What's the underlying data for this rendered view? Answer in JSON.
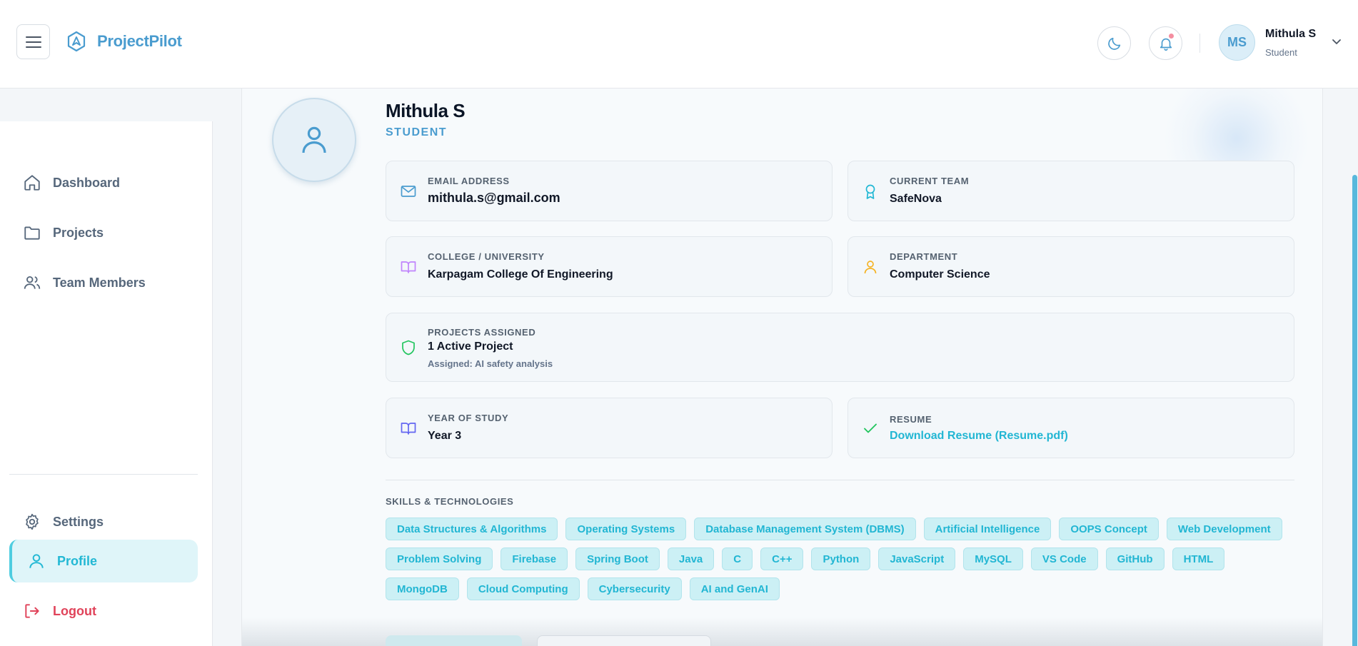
{
  "app": {
    "brand_name": "ProjectPilot",
    "accent_color": "#4a9ccf",
    "cyan_color": "#22b6d3"
  },
  "header": {
    "menu_icon": "hamburger-icon",
    "theme_icon": "moon-icon",
    "notification_icon": "bell-icon",
    "user": {
      "initials": "MS",
      "name": "Mithula S",
      "role": "Student"
    }
  },
  "sidebar": {
    "items": [
      {
        "label": "Dashboard",
        "icon": "home-icon"
      },
      {
        "label": "Projects",
        "icon": "folder-icon"
      },
      {
        "label": "Team Members",
        "icon": "users-icon"
      }
    ],
    "bottom": [
      {
        "label": "Settings",
        "icon": "gear-icon"
      },
      {
        "label": "Profile",
        "icon": "user-icon",
        "active": true
      },
      {
        "label": "Logout",
        "icon": "logout-icon"
      }
    ]
  },
  "profile": {
    "name": "Mithula S",
    "role": "STUDENT",
    "email": {
      "label": "EMAIL ADDRESS",
      "value": "mithula.s@gmail.com"
    },
    "team": {
      "label": "CURRENT TEAM",
      "value": "SafeNova"
    },
    "college": {
      "label": "COLLEGE / UNIVERSITY",
      "value": "Karpagam College Of Engineering"
    },
    "department": {
      "label": "DEPARTMENT",
      "value": "Computer Science"
    },
    "projects": {
      "label": "PROJECTS ASSIGNED",
      "value": "1 Active Project",
      "sub": "Assigned: AI safety analysis"
    },
    "year": {
      "label": "YEAR OF STUDY",
      "value": "Year 3"
    },
    "resume": {
      "label": "RESUME",
      "value": "Download Resume (Resume.pdf)"
    },
    "skills_title": "SKILLS & TECHNOLOGIES",
    "skills": [
      "Data Structures & Algorithms",
      "Operating Systems",
      "Database Management System (DBMS)",
      "Artificial Intelligence",
      "OOPS Concept",
      "Web Development",
      "Problem Solving",
      "Firebase",
      "Spring Boot",
      "Java",
      "C",
      "C++",
      "Python",
      "JavaScript",
      "MySQL",
      "VS Code",
      "GitHub",
      "HTML",
      "MongoDB",
      "Cloud Computing",
      "Cybersecurity",
      "AI and GenAI"
    ]
  }
}
